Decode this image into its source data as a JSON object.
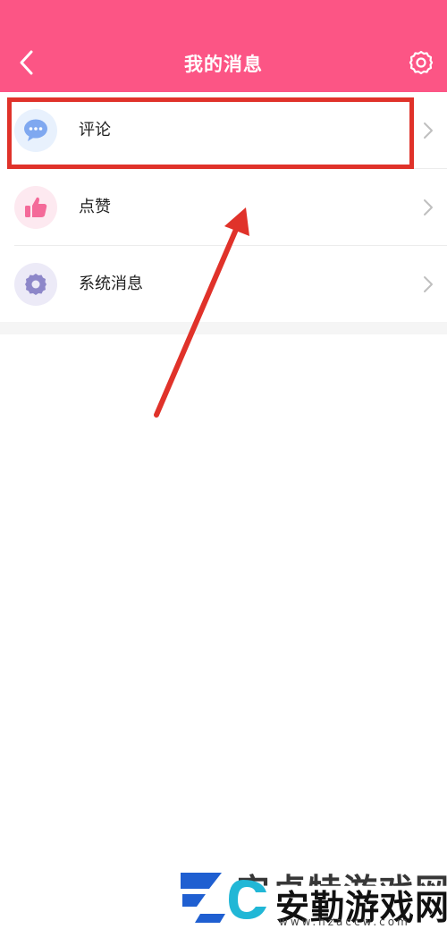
{
  "header": {
    "title": "我的消息",
    "back_icon": "chevron-left-icon",
    "settings_icon": "gear-icon",
    "background_color": "#fc5585"
  },
  "list": {
    "items": [
      {
        "label": "评论",
        "icon": "comment-bubble-icon",
        "icon_color": "#7fa8f0",
        "icon_bg": "#e8f1fd"
      },
      {
        "label": "点赞",
        "icon": "thumbs-up-icon",
        "icon_color": "#f46a99",
        "icon_bg": "#fde9f0"
      },
      {
        "label": "系统消息",
        "icon": "gear-icon",
        "icon_color": "#8d87c9",
        "icon_bg": "#eceaf7"
      }
    ]
  },
  "annotation": {
    "highlight_color": "#e0322a",
    "arrow_color": "#e0322a"
  },
  "watermark": {
    "back_text": "安卓特游戏网",
    "name": "安勤游戏网",
    "url": "www.hzaccw.com"
  }
}
